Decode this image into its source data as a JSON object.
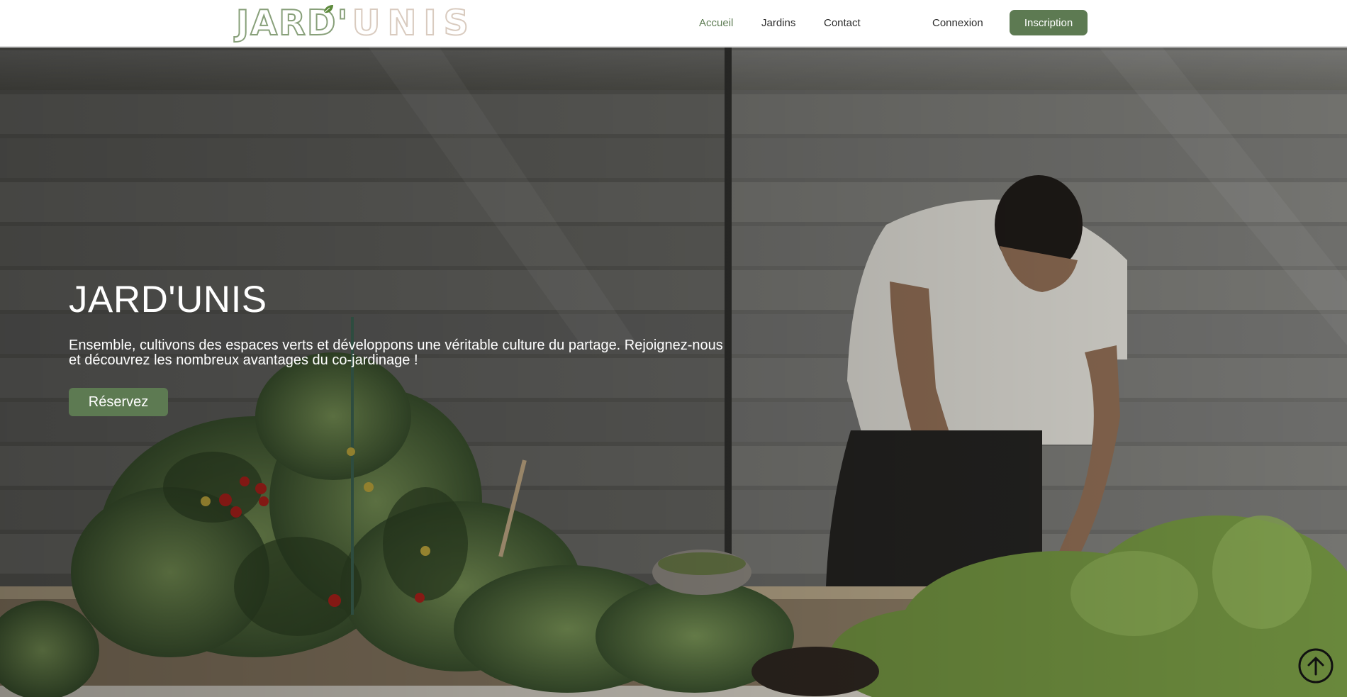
{
  "header": {
    "logo": {
      "part1": "JARD'",
      "part2": "UNIS",
      "icon": "leaf-icon"
    },
    "nav": {
      "home": "Accueil",
      "gardens": "Jardins",
      "contact": "Contact",
      "login": "Connexion",
      "signup": "Inscription"
    }
  },
  "hero": {
    "title": "JARD'UNIS",
    "tagline": "Ensemble, cultivons des espaces verts et développons une véritable culture du partage. Rejoignez-nous et découvrez les nombreux avantages du co-jardinage !",
    "cta": "Réservez",
    "scroll_icon": "arrow-up-circle-icon"
  },
  "colors": {
    "brand_green": "#5d7a52",
    "logo_green": "#88a07a",
    "logo_beige": "#d9cbbf",
    "active_nav": "#5f7d55"
  }
}
